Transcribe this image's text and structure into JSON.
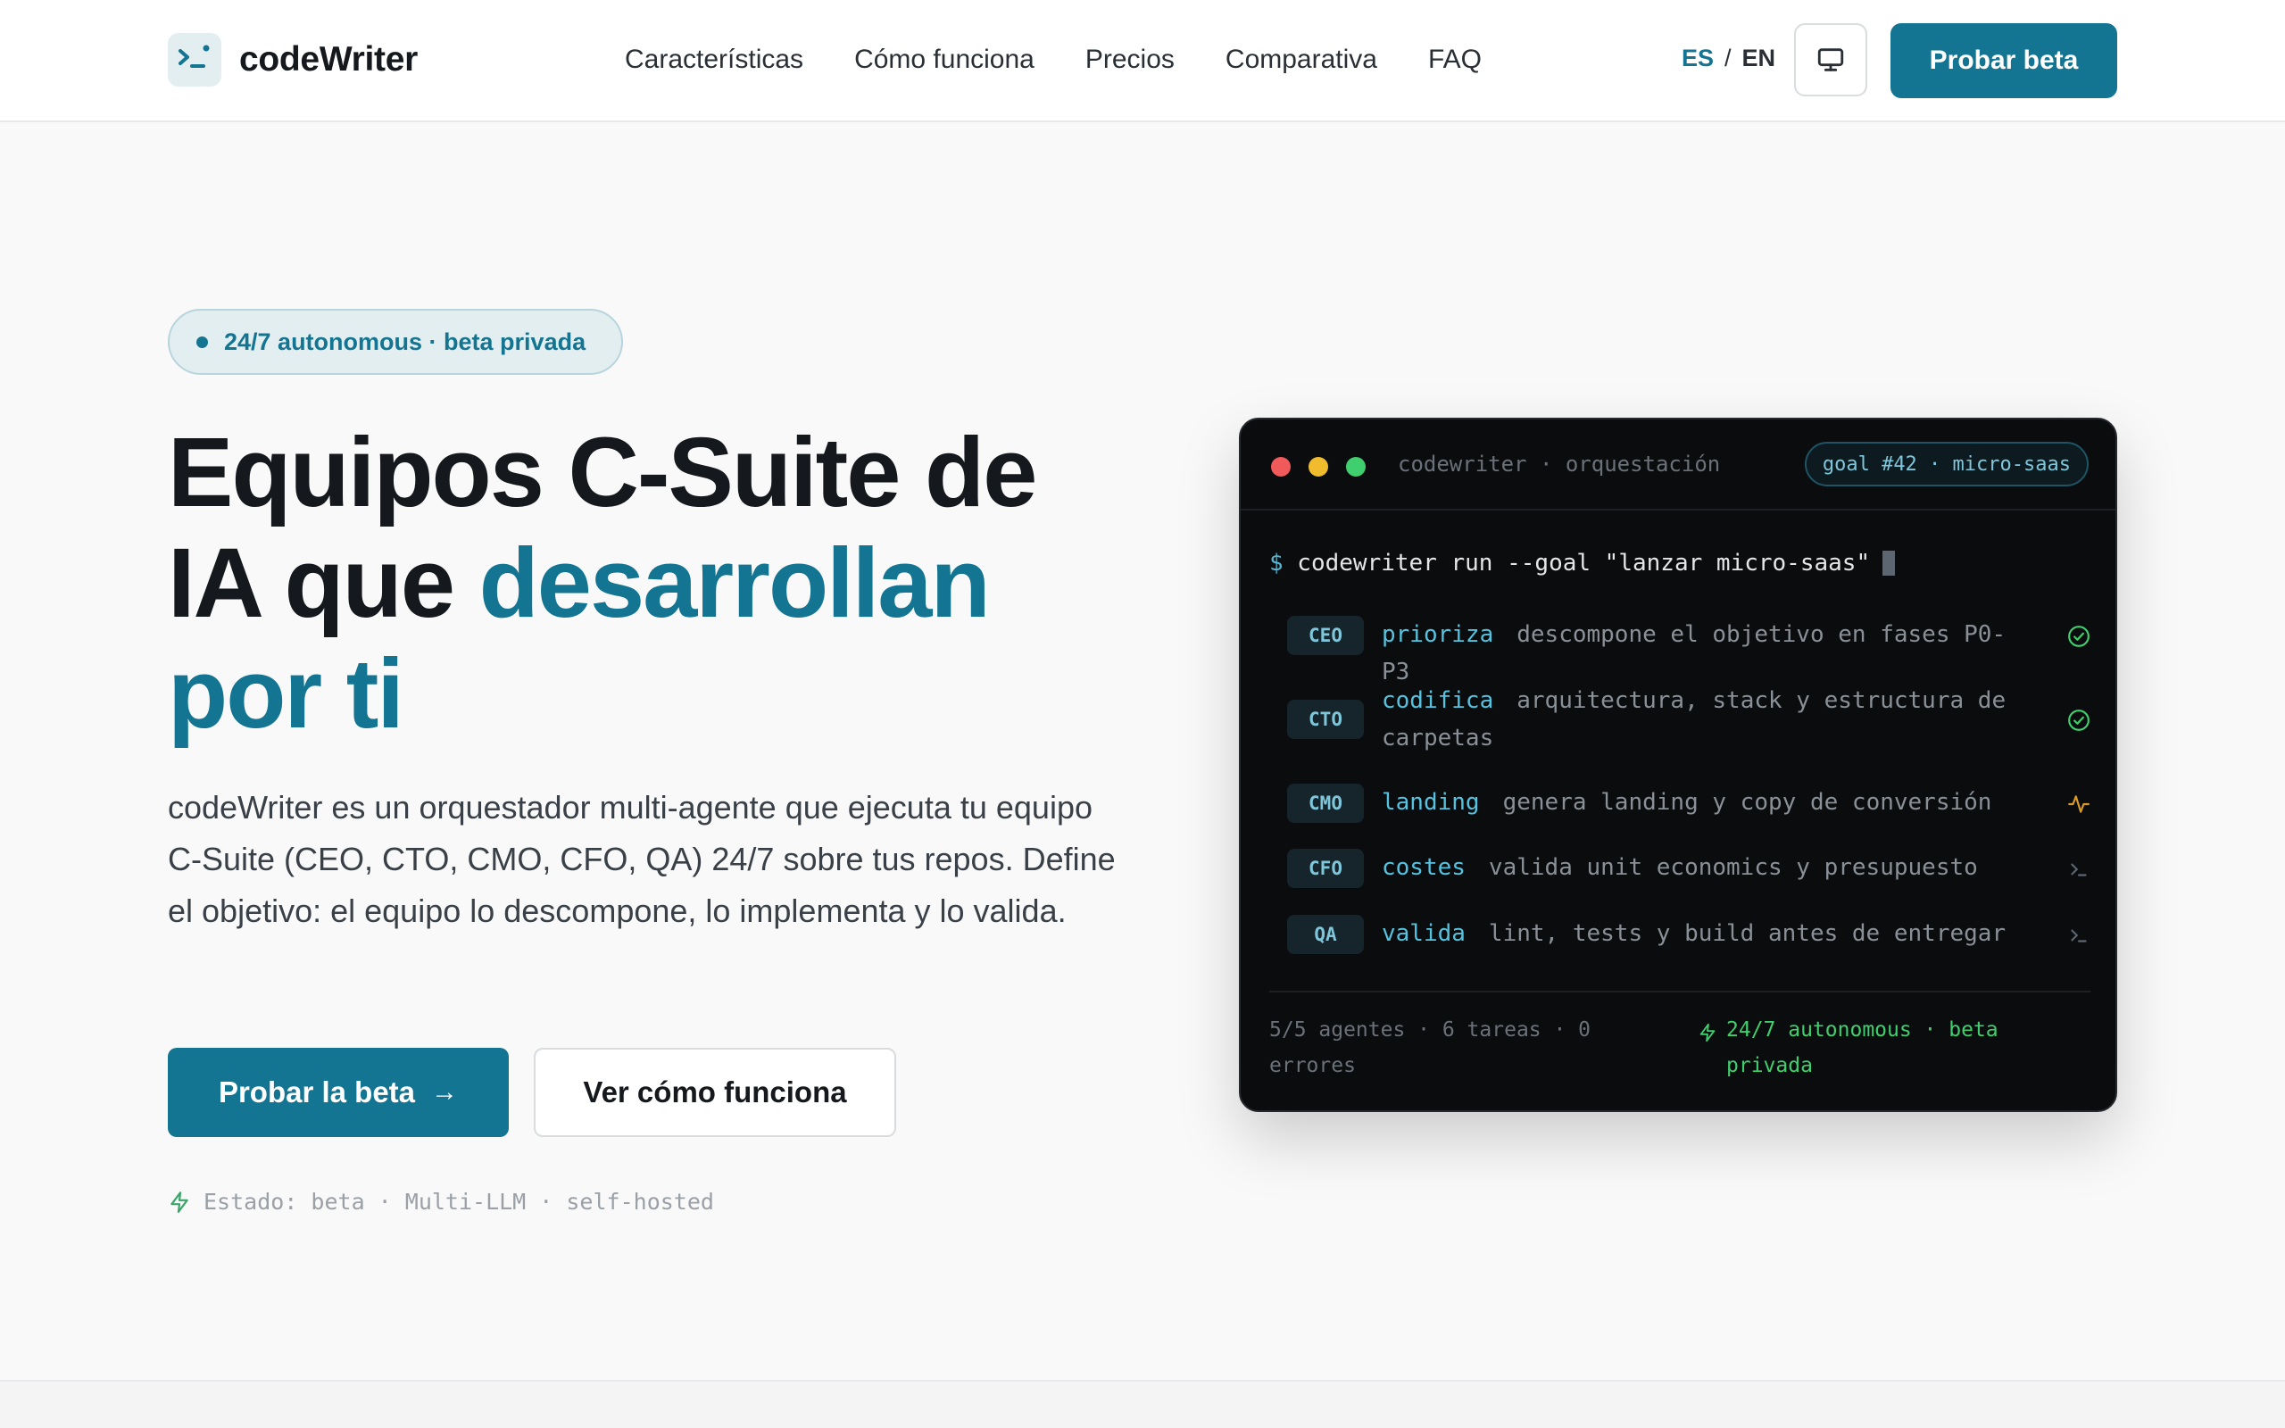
{
  "brand": {
    "name": "codeWriter",
    "logo_icon": "terminal-prompt-icon"
  },
  "nav": {
    "items": [
      "Características",
      "Cómo funciona",
      "Precios",
      "Comparativa",
      "FAQ"
    ]
  },
  "lang": {
    "es": "ES",
    "separator": "/",
    "en": "EN"
  },
  "header": {
    "theme_icon": "monitor-icon",
    "cta_label": "Probar beta"
  },
  "hero": {
    "pill": "24/7 autonomous · beta privada",
    "title_part1": "Equipos C-Suite de IA que ",
    "title_accent": "desarrollan por ti",
    "description": "codeWriter es un orquestador multi-agente que ejecuta tu equipo C-Suite (CEO, CTO, CMO, CFO, QA) 24/7 sobre tus repos. Define el objetivo: el equipo lo descompone, lo implementa y lo valida.",
    "primary_cta": "Probar la beta",
    "primary_cta_arrow": "→",
    "secondary_cta": "Ver cómo funciona",
    "status": "Estado: beta · Multi-LLM · self-hosted"
  },
  "terminal": {
    "title": "codewriter · orquestación",
    "goal_badge": "goal #42 · micro-saas",
    "prompt": "$",
    "command": " codewriter run --goal \"lanzar micro-saas\"",
    "rows": [
      {
        "role": "CEO",
        "action": "prioriza",
        "desc": "descompone el objetivo en fases P0-P3",
        "status": "done",
        "icon": "check-circle-icon"
      },
      {
        "role": "CTO",
        "action": "codifica",
        "desc": "arquitectura, stack y estructura de carpetas",
        "status": "done",
        "icon": "check-circle-icon"
      },
      {
        "role": "CMO",
        "action": "landing",
        "desc": "genera landing y copy de conversión",
        "status": "running",
        "icon": "activity-icon"
      },
      {
        "role": "CFO",
        "action": "costes",
        "desc": "valida unit economics y presupuesto",
        "status": "queued",
        "icon": "terminal-prompt-icon"
      },
      {
        "role": "QA",
        "action": "valida",
        "desc": "lint, tests y build antes de entregar",
        "status": "queued",
        "icon": "terminal-prompt-icon"
      }
    ],
    "footer_left": "5/5 agentes · 6 tareas · 0 errores",
    "footer_right": "24/7 autonomous · beta privada"
  },
  "colors": {
    "accent": "#137591",
    "terminal_bg": "#0b0c0e",
    "success": "#3fcf6e",
    "running": "#d89b2b"
  }
}
